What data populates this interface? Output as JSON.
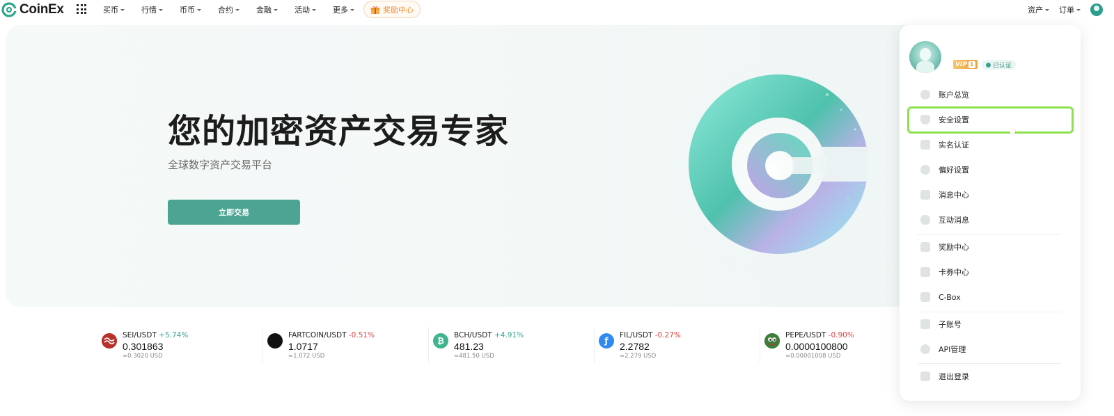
{
  "brand": {
    "name": "CoinEx"
  },
  "nav": {
    "items": [
      "买币",
      "行情",
      "币币",
      "合约",
      "金融",
      "活动",
      "更多"
    ],
    "reward": "奖励中心",
    "right": [
      "资产",
      "订单"
    ]
  },
  "hero": {
    "title": "您的加密资产交易专家",
    "subtitle": "全球数字资产交易平台",
    "cta": "立即交易"
  },
  "tickers": [
    {
      "pair": "SEI/USDT",
      "change": "+5.74%",
      "direction": "up",
      "price": "0.301863",
      "usd": "≈0.3020 USD",
      "icon": "sei-icon",
      "color": "#c0392b",
      "glyph": ""
    },
    {
      "pair": "FARTCOIN/USDT",
      "change": "-0.51%",
      "direction": "down",
      "price": "1.0717",
      "usd": "≈1.072 USD",
      "icon": "fartcoin-icon",
      "color": "#111111",
      "glyph": ""
    },
    {
      "pair": "BCH/USDT",
      "change": "+4.91%",
      "direction": "up",
      "price": "481.23",
      "usd": "≈481.50 USD",
      "icon": "bch-icon",
      "color": "#3fb58f",
      "glyph": "₿"
    },
    {
      "pair": "FIL/USDT",
      "change": "-0.27%",
      "direction": "down",
      "price": "2.2782",
      "usd": "≈2.279 USD",
      "icon": "fil-icon",
      "color": "#2f8af0",
      "glyph": "ƒ"
    },
    {
      "pair": "PEPE/USDT",
      "change": "-0.90%",
      "direction": "down",
      "price": "0.0000100800",
      "usd": "≈0.00001008 USD",
      "icon": "pepe-icon",
      "color": "#3a8a3a",
      "glyph": ""
    }
  ],
  "account_menu": {
    "vip_label": "VIP",
    "vip_level": "1",
    "verified": "已认证",
    "groups": [
      [
        {
          "label": "账户总览",
          "icon": "pie-chart-icon"
        },
        {
          "label": "安全设置",
          "icon": "shield-icon"
        },
        {
          "label": "实名认证",
          "icon": "id-card-icon"
        },
        {
          "label": "偏好设置",
          "icon": "settings-icon"
        },
        {
          "label": "消息中心",
          "icon": "mail-icon"
        },
        {
          "label": "互动消息",
          "icon": "chat-icon"
        }
      ],
      [
        {
          "label": "奖励中心",
          "icon": "gift-icon"
        },
        {
          "label": "卡券中心",
          "icon": "coupon-icon"
        },
        {
          "label": "C-Box",
          "icon": "box-icon"
        }
      ],
      [
        {
          "label": "子账号",
          "icon": "sub-account-icon"
        },
        {
          "label": "API管理",
          "icon": "api-icon"
        }
      ],
      [
        {
          "label": "退出登录",
          "icon": "logout-icon"
        }
      ]
    ]
  },
  "colors": {
    "accent": "#4ba592",
    "highlight": "#8be04e",
    "up": "#2fa58f",
    "down": "#e0443c"
  }
}
